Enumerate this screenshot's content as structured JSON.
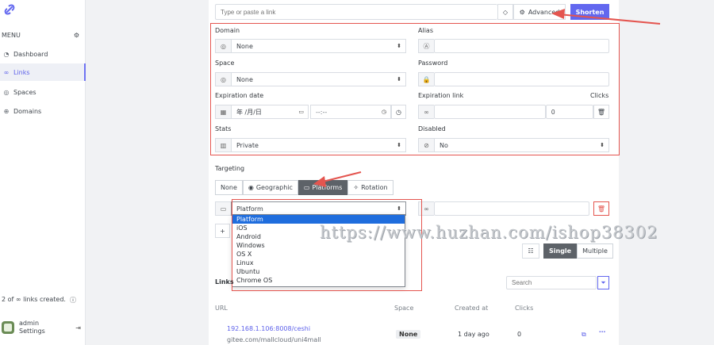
{
  "sidebar": {
    "menu_label": "MENU",
    "items": [
      {
        "label": "Dashboard",
        "icon": "dashboard-icon"
      },
      {
        "label": "Links",
        "icon": "link-icon"
      },
      {
        "label": "Spaces",
        "icon": "spaces-icon"
      },
      {
        "label": "Domains",
        "icon": "domain-icon"
      }
    ],
    "links_created": "2 of ∞ links created.",
    "user": {
      "name": "admin",
      "settings_label": "Settings"
    }
  },
  "shortener": {
    "placeholder": "Type or paste a link",
    "advanced_label": "Advanced",
    "shorten_label": "Shorten"
  },
  "advanced": {
    "domain": {
      "label": "Domain",
      "value": "None"
    },
    "alias": {
      "label": "Alias",
      "value": ""
    },
    "space": {
      "label": "Space",
      "value": "None"
    },
    "password": {
      "label": "Password",
      "value": ""
    },
    "expiration_date": {
      "label": "Expiration date",
      "date_value": "年 /月/日",
      "time_value": "--:--"
    },
    "expiration_link": {
      "label": "Expiration link",
      "value": ""
    },
    "clicks": {
      "label": "Clicks",
      "value": "0"
    },
    "stats": {
      "label": "Stats",
      "value": "Private"
    },
    "disabled": {
      "label": "Disabled",
      "value": "No"
    }
  },
  "targeting": {
    "label": "Targeting",
    "tabs": [
      "None",
      "Geographic",
      "Platforms",
      "Rotation"
    ],
    "active_tab": "Platforms",
    "platform_select_value": "Platform",
    "platform_options": [
      "Platform",
      "iOS",
      "Android",
      "Windows",
      "OS X",
      "Linux",
      "Ubuntu",
      "Chrome OS"
    ],
    "add_label": "+",
    "mode_tabs": [
      "Single",
      "Multiple"
    ],
    "active_mode": "Single"
  },
  "links_section": {
    "title": "Links",
    "search_placeholder": "Search",
    "columns": [
      "URL",
      "Space",
      "Created at",
      "Clicks"
    ],
    "rows": [
      {
        "short_url": "192.168.1.106:8008/ceshi",
        "target_url": "gitee.com/mallcloud/uni4mall",
        "space": "None",
        "created": "1 day ago",
        "clicks": "0"
      }
    ]
  },
  "watermark": "https://www.huzhan.com/ishop38302",
  "colors": {
    "accent": "#6267ef",
    "annotation": "#e4554f"
  }
}
